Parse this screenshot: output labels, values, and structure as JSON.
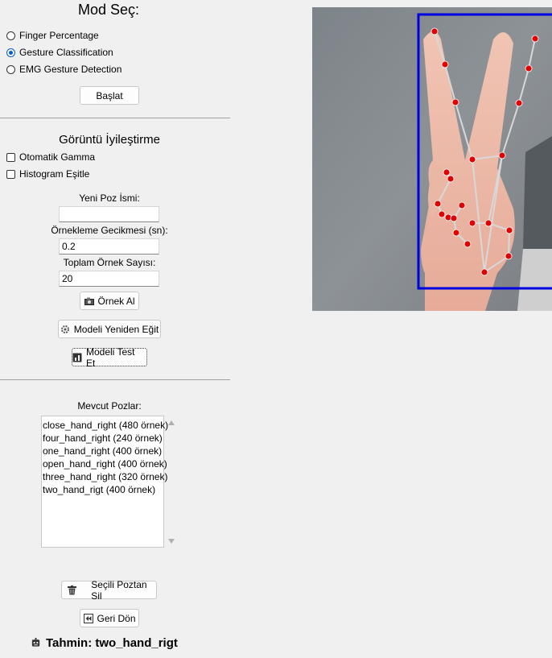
{
  "mode": {
    "title": "Mod Seç:",
    "options": [
      {
        "label": "Finger Percentage",
        "selected": false
      },
      {
        "label": "Gesture Classification",
        "selected": true
      },
      {
        "label": "EMG Gesture Detection",
        "selected": false
      }
    ],
    "start_button": "Başlat"
  },
  "enhance": {
    "title": "Görüntü İyileştirme",
    "auto_gamma": "Otomatik Gamma",
    "histogram_eq": "Histogram Eşitle"
  },
  "training": {
    "new_pose_label": "Yeni Poz İsmi:",
    "new_pose_value": "",
    "delay_label": "Örnekleme Gecikmesi (sn):",
    "delay_value": "0.2",
    "samples_label": "Toplam Örnek Sayısı:",
    "samples_value": "20",
    "sample_button": "Örnek Al",
    "retrain_button": "Modeli Yeniden Eğit",
    "test_button": "Modeli Test Et"
  },
  "poses": {
    "label": "Mevcut Pozlar:",
    "items": [
      "close_hand_right (480 örnek)",
      "four_hand_right (240 örnek)",
      "one_hand_right (400 örnek)",
      "open_hand_right (400 örnek)",
      "three_hand_right (320 örnek)",
      "two_hand_rigt (400 örnek)"
    ],
    "delete_button": "Seçili Poztan Sil",
    "back_button": "Geri Dön"
  },
  "prediction": {
    "text": "Tahmin: two_hand_rigt"
  },
  "colors": {
    "accent": "#0a5fc4",
    "bbox": "#0000e0",
    "landmark": "#e00000",
    "skeleton": "#d8d8d8"
  }
}
